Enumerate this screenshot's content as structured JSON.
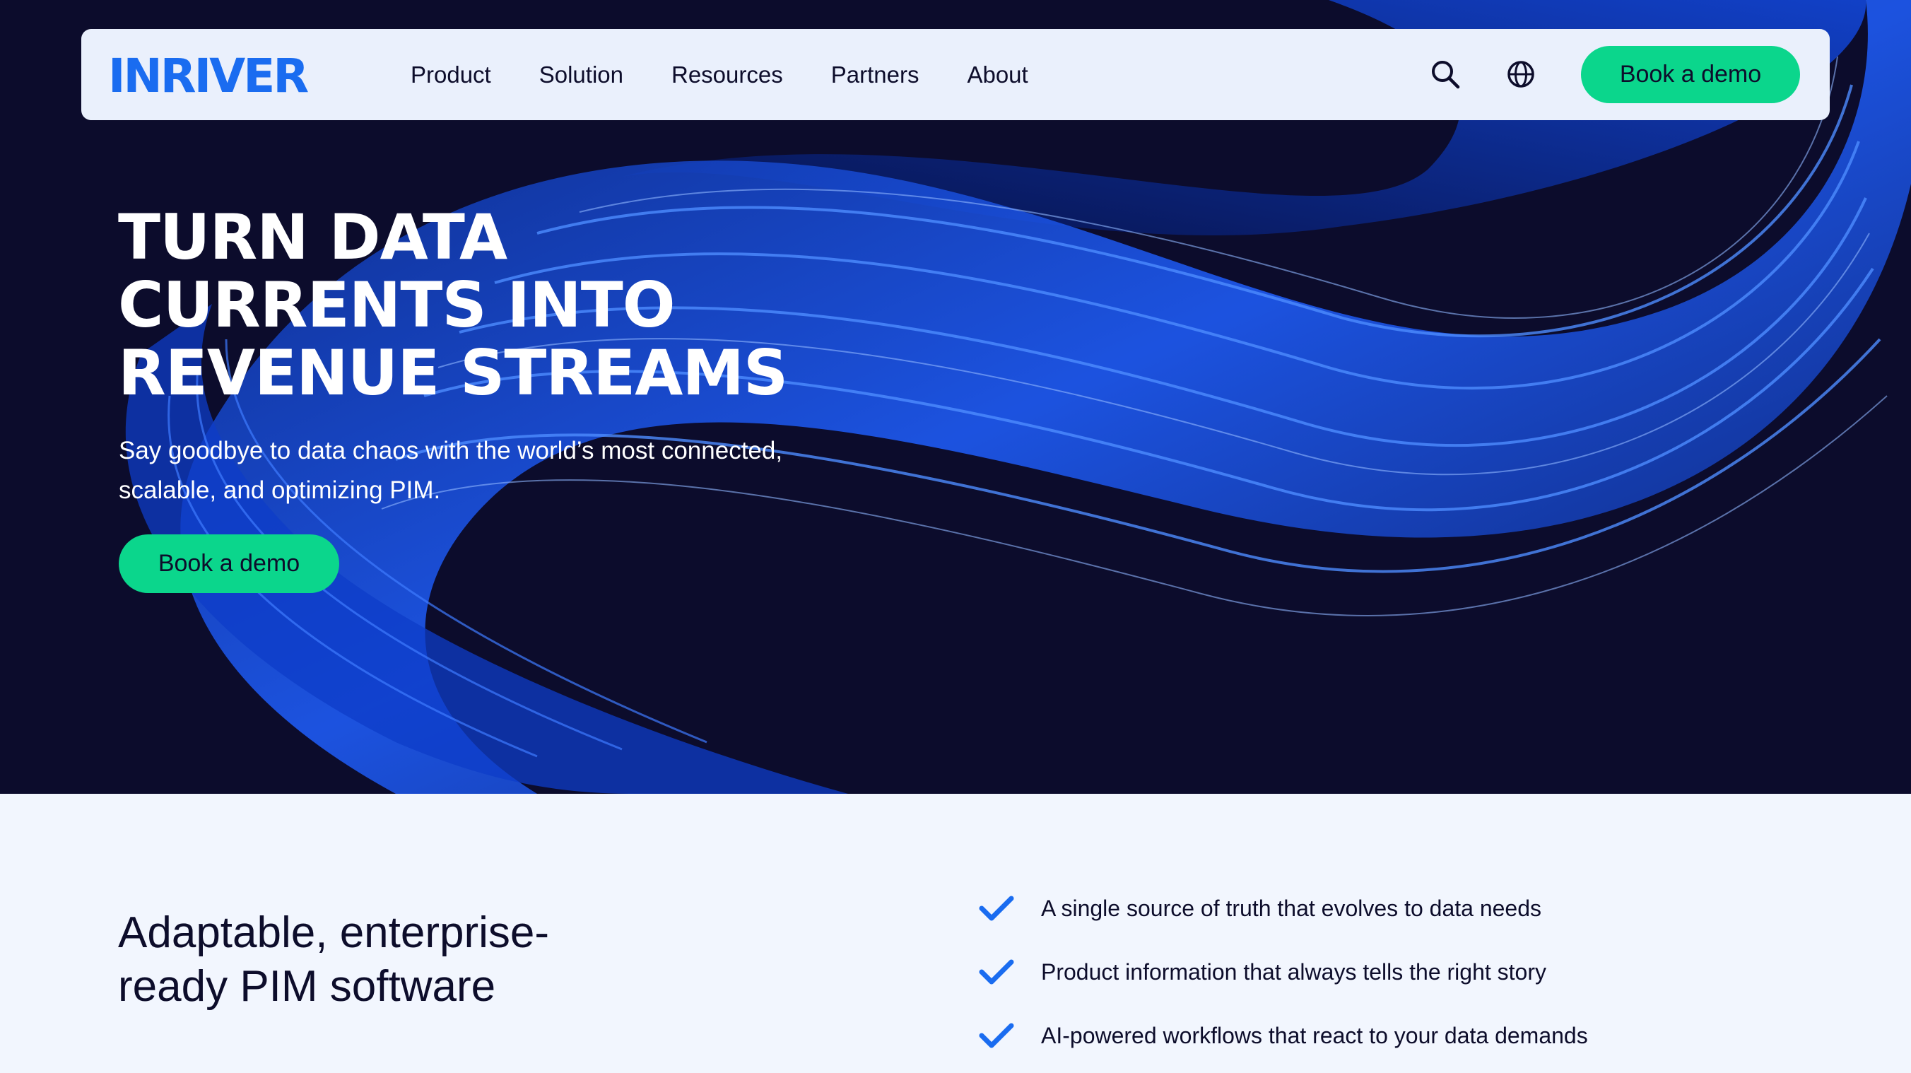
{
  "nav": {
    "logo_text": "INRIVER",
    "links": [
      "Product",
      "Solution",
      "Resources",
      "Partners",
      "About"
    ],
    "search_icon": "search-icon",
    "language_icon": "globe-icon",
    "cta_label": "Book a demo"
  },
  "hero": {
    "title": "TURN DATA\nCURRENTS INTO\nREVENUE STREAMS",
    "subtitle": "Say goodbye to data chaos with the world’s most connected, scalable, and optimizing PIM.",
    "cta_label": "Book a demo"
  },
  "features": {
    "title": "Adaptable, enterprise-ready PIM software",
    "items": [
      "A single source of truth that evolves to data needs",
      "Product information that always tells the right story",
      "AI-powered workflows that react to your data demands"
    ],
    "check_icon": "checkmark-icon"
  },
  "colors": {
    "hero_bg": "#0c0c2c",
    "nav_bg": "#eaf0fc",
    "accent_green": "#0bd68c",
    "brand_blue": "#1a6cf0",
    "text_dark": "#0d0d2b",
    "section_bg": "#f2f6fe"
  }
}
